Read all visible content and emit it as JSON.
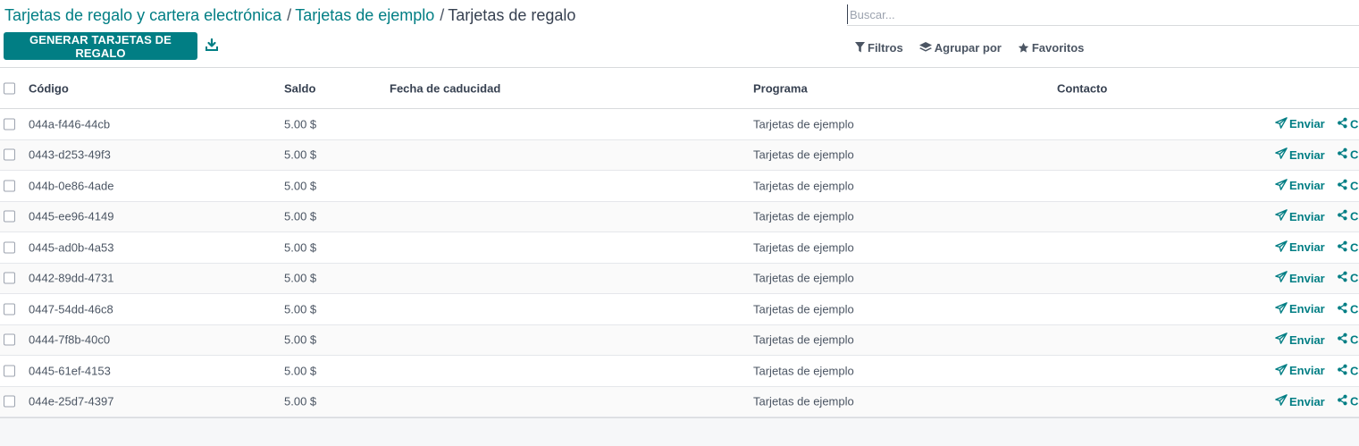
{
  "breadcrumb": {
    "items": [
      {
        "label": "Tarjetas de regalo y cartera electrónica"
      },
      {
        "label": "Tarjetas de ejemplo"
      }
    ],
    "separator": "/",
    "current": "Tarjetas de regalo"
  },
  "toolbar": {
    "generate_label": "GENERAR TARJETAS DE REGALO"
  },
  "search": {
    "placeholder": "Buscar...",
    "value": ""
  },
  "filters": {
    "filters_label": "Filtros",
    "group_by_label": "Agrupar por",
    "favorites_label": "Favoritos"
  },
  "table": {
    "columns": {
      "code": "Código",
      "balance": "Saldo",
      "expiration": "Fecha de caducidad",
      "program": "Programa",
      "contact": "Contacto"
    },
    "send_label": "Enviar",
    "share_label": "C",
    "rows": [
      {
        "code": "044a-f446-44cb",
        "balance": "5.00 $",
        "expiration": "",
        "program": "Tarjetas de ejemplo",
        "contact": ""
      },
      {
        "code": "0443-d253-49f3",
        "balance": "5.00 $",
        "expiration": "",
        "program": "Tarjetas de ejemplo",
        "contact": ""
      },
      {
        "code": "044b-0e86-4ade",
        "balance": "5.00 $",
        "expiration": "",
        "program": "Tarjetas de ejemplo",
        "contact": ""
      },
      {
        "code": "0445-ee96-4149",
        "balance": "5.00 $",
        "expiration": "",
        "program": "Tarjetas de ejemplo",
        "contact": ""
      },
      {
        "code": "0445-ad0b-4a53",
        "balance": "5.00 $",
        "expiration": "",
        "program": "Tarjetas de ejemplo",
        "contact": ""
      },
      {
        "code": "0442-89dd-4731",
        "balance": "5.00 $",
        "expiration": "",
        "program": "Tarjetas de ejemplo",
        "contact": ""
      },
      {
        "code": "0447-54dd-46c8",
        "balance": "5.00 $",
        "expiration": "",
        "program": "Tarjetas de ejemplo",
        "contact": ""
      },
      {
        "code": "0444-7f8b-40c0",
        "balance": "5.00 $",
        "expiration": "",
        "program": "Tarjetas de ejemplo",
        "contact": ""
      },
      {
        "code": "0445-61ef-4153",
        "balance": "5.00 $",
        "expiration": "",
        "program": "Tarjetas de ejemplo",
        "contact": ""
      },
      {
        "code": "044e-25d7-4397",
        "balance": "5.00 $",
        "expiration": "",
        "program": "Tarjetas de ejemplo",
        "contact": ""
      }
    ]
  },
  "icons": {
    "download": "download-icon",
    "filter": "filter-icon",
    "group_by": "layers-icon",
    "favorites": "star-icon",
    "send": "paper-plane-icon",
    "share": "share-icon"
  },
  "colors": {
    "accent": "#017e84",
    "text": "#374151",
    "background": "#f6f7f9",
    "border": "#d8dadd"
  }
}
